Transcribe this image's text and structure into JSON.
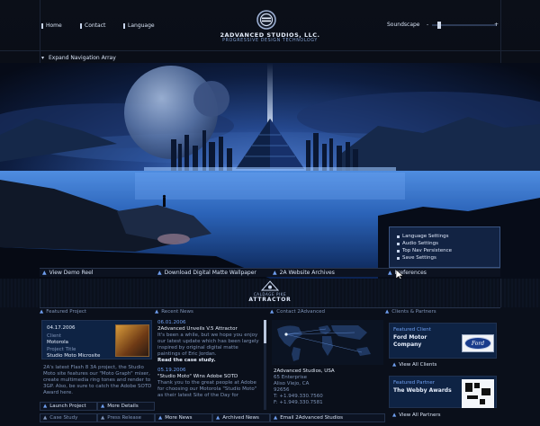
{
  "nav": {
    "home": "Home",
    "contact": "Contact",
    "language": "Language",
    "soundscape": "Soundscape",
    "minus": "-",
    "plus": "+",
    "expand": "Expand Navigation Array"
  },
  "brand": {
    "name": "2ADVANCED STUDIOS, LLC.",
    "tagline": "PROGRESSIVE DESIGN TECHNOLOGY"
  },
  "hero_links": {
    "demo_reel": "View Demo Reel",
    "matte": "Download Digital Matte Wallpaper",
    "archives": "2A Website Archives",
    "preferences": "Preferences"
  },
  "preferences_menu": [
    "Language Settings",
    "Audio Settings",
    "Top Nav Persistence",
    "Save Settings"
  ],
  "band": {
    "logo_line1": "CALDAGE PIKE",
    "logo_line2": "ATTRACTOR"
  },
  "featured_project": {
    "heading": "Featured Project",
    "date": "04.17.2006",
    "client_label": "Client",
    "client": "Motorola",
    "project_label": "Project Title",
    "project": "Studio Moto Microsite",
    "body": "2A's latest Flash 8 3A project, the Studio Moto site features our \"Moto Graph\" mixer, create multimedia ring tones and render to 3GP. Also, be sure to catch the Adobe SOTD Award here.",
    "launch": "Launch Project",
    "more": "More Details",
    "case": "Case Study",
    "release": "Press Release"
  },
  "recent_news": {
    "heading": "Recent News",
    "items": [
      {
        "date": "06.01.2006",
        "title": "2Advanced Unveils V.5 Attractor",
        "body": "It's been a while, but we hope you enjoy our latest update which has been largely inspired by original digital matte paintings of Eric Jordan.",
        "link": "Read the case study."
      },
      {
        "date": "05.19.2006",
        "title": "\"Studio Moto\" Wins Adobe SOTD",
        "body": "Thank you to the great people at Adobe for choosing our Motorola \"Studio Moto\" as their latest Site of the Day for",
        "link": ""
      }
    ],
    "more": "More News",
    "archived": "Archived News"
  },
  "contact": {
    "heading": "Contact 2Advanced",
    "company": "2Advanced Studios, USA",
    "address1": "65 Enterprise",
    "address2": "Aliso Viejo, CA",
    "zip": "92656",
    "phone": "T: +1.949.330.7560",
    "fax": "F: +1.949.330.7581",
    "email": "Email 2Advanced Studios"
  },
  "clients": {
    "heading": "Clients & Partners",
    "featured_client_label": "Featured Client",
    "featured_client": "Ford Motor Company",
    "view_clients": "View All Clients",
    "featured_partner_label": "Featured Partner",
    "featured_partner": "The Webby Awards",
    "view_partners": "View All Partners",
    "ford_logo": "Ford"
  }
}
